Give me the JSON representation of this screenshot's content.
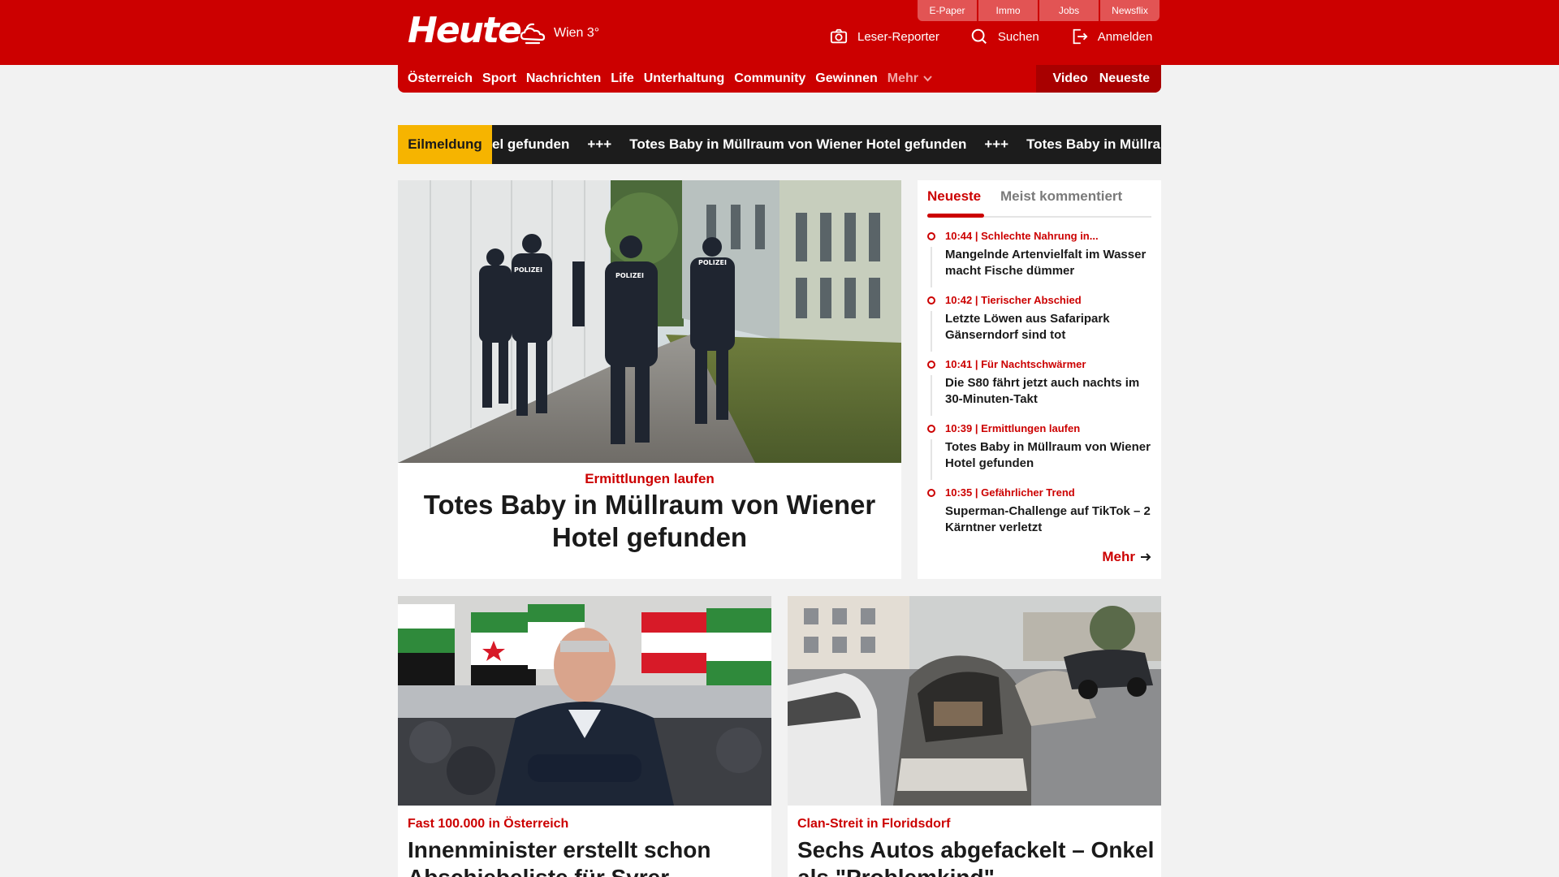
{
  "header": {
    "logo": "Heute",
    "weather": "Wien 3°",
    "service_tabs": [
      "E-Paper",
      "Immo",
      "Jobs",
      "Newsflix"
    ],
    "actions": {
      "reporter": "Leser-Reporter",
      "search": "Suchen",
      "login": "Anmelden"
    }
  },
  "nav": {
    "items": [
      "Österreich",
      "Sport",
      "Nachrichten",
      "Life",
      "Unterhaltung",
      "Community",
      "Gewinnen"
    ],
    "more": "Mehr",
    "right": [
      "Video",
      "Neueste"
    ]
  },
  "breaking": {
    "label": "Eilmeldung",
    "separator": "+++",
    "ticker": [
      "el gefunden",
      "Totes Baby in Müllraum von Wiener Hotel gefunden",
      "Totes Baby in Müllraum"
    ]
  },
  "hero": {
    "kicker": "Ermittlungen laufen",
    "title": "Totes Baby in Müllraum von Wiener Hotel gefunden"
  },
  "sidebar": {
    "tabs": [
      "Neueste",
      "Meist kommentiert"
    ],
    "items": [
      {
        "meta": "10:44 | Schlechte Nahrung in...",
        "headline": "Mangelnde Artenvielfalt im Wasser macht Fische dümmer"
      },
      {
        "meta": "10:42 | Tierischer Abschied",
        "headline": "Letzte Löwen aus Safaripark Gänserndorf sind tot"
      },
      {
        "meta": "10:41 | Für Nachtschwärmer",
        "headline": "Die S80 fährt jetzt auch nachts im 30-Minuten-Takt"
      },
      {
        "meta": "10:39 | Ermittlungen laufen",
        "headline": "Totes Baby in Müllraum von Wiener Hotel gefunden"
      },
      {
        "meta": "10:35 | Gefährlicher Trend",
        "headline": "Superman-Challenge auf TikTok – 2 Kärntner verletzt"
      }
    ],
    "more": "Mehr"
  },
  "cards": [
    {
      "kicker": "Fast 100.000 in Österreich",
      "title": "Innenminister erstellt schon Abschiebeliste für Syrer"
    },
    {
      "kicker": "Clan-Streit in Floridsdorf",
      "title": "Sechs Autos abgefackelt – Onkel als \"Problemkind\""
    }
  ],
  "colors": {
    "brand": "#cc0000",
    "breaking_label": "#f6b400",
    "ticker_bg": "#1c1c1c"
  }
}
